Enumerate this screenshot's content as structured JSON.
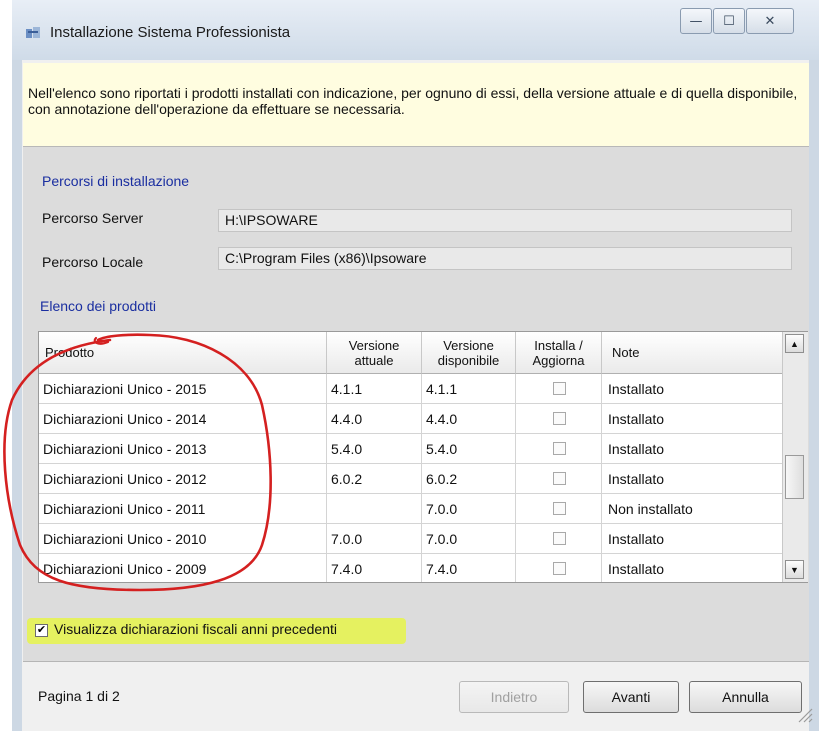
{
  "window": {
    "title": "Installazione Sistema Professionista",
    "minimize": "—",
    "maximize": "☐",
    "close": "✕"
  },
  "info_text": "Nell'elenco sono riportati i prodotti installati con indicazione, per ognuno di essi, della versione attuale e di quella disponibile, con annotazione dell'operazione da effettuare se necessaria.",
  "paths": {
    "section_title": "Percorsi di installazione",
    "server_label": "Percorso Server",
    "server_value": "H:\\IPSOWARE",
    "local_label": "Percorso Locale",
    "local_value": "C:\\Program Files (x86)\\Ipsoware"
  },
  "products": {
    "section_title": "Elenco dei prodotti",
    "headers": {
      "product": "Prodotto",
      "current_1": "Versione",
      "current_2": "attuale",
      "available_1": "Versione",
      "available_2": "disponibile",
      "install_1": "Installa /",
      "install_2": "Aggiorna",
      "notes": "Note"
    },
    "rows": [
      {
        "product": "Dichiarazioni Unico - 2015",
        "current": "4.1.1",
        "available": "4.1.1",
        "checked": false,
        "notes": "Installato"
      },
      {
        "product": "Dichiarazioni Unico - 2014",
        "current": "4.4.0",
        "available": "4.4.0",
        "checked": false,
        "notes": "Installato"
      },
      {
        "product": "Dichiarazioni Unico - 2013",
        "current": "5.4.0",
        "available": "5.4.0",
        "checked": false,
        "notes": "Installato"
      },
      {
        "product": "Dichiarazioni Unico - 2012",
        "current": "6.0.2",
        "available": "6.0.2",
        "checked": false,
        "notes": "Installato"
      },
      {
        "product": "Dichiarazioni Unico - 2011",
        "current": "",
        "available": "7.0.0",
        "checked": false,
        "notes": "Non installato"
      },
      {
        "product": "Dichiarazioni Unico - 2010",
        "current": "7.0.0",
        "available": "7.0.0",
        "checked": false,
        "notes": "Installato"
      },
      {
        "product": "Dichiarazioni Unico - 2009",
        "current": "7.4.0",
        "available": "7.4.0",
        "checked": false,
        "notes": "Installato"
      }
    ]
  },
  "show_previous": {
    "label": "Visualizza dichiarazioni fiscali anni precedenti",
    "checked": true
  },
  "footer": {
    "page_info": "Pagina 1 di 2",
    "back": "Indietro",
    "next": "Avanti",
    "cancel": "Annulla"
  },
  "colors": {
    "annotation_circle": "#d42020",
    "highlight": "#e6f44a",
    "section_title": "#1a2ea0",
    "info_background": "#fffde0"
  }
}
